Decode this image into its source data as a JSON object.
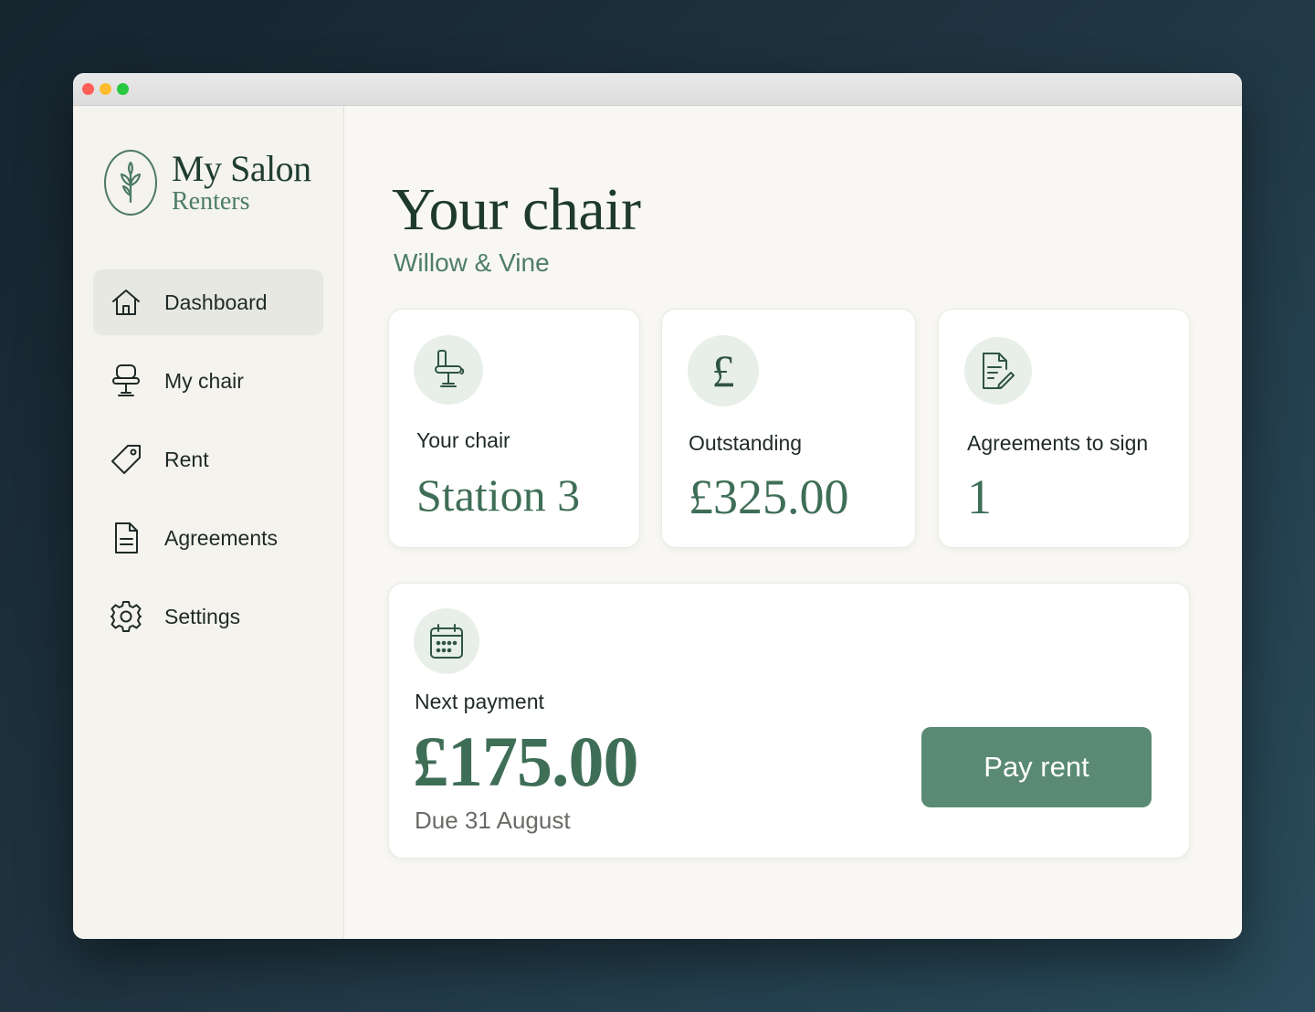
{
  "brand": {
    "name": "My Salon",
    "subtitle": "Renters"
  },
  "nav": [
    {
      "label": "Dashboard",
      "icon": "home-icon",
      "active": true
    },
    {
      "label": "My chair",
      "icon": "chair-icon",
      "active": false
    },
    {
      "label": "Rent",
      "icon": "tag-icon",
      "active": false
    },
    {
      "label": "Agreements",
      "icon": "document-icon",
      "active": false
    },
    {
      "label": "Settings",
      "icon": "gear-icon",
      "active": false
    }
  ],
  "page": {
    "title": "Your chair",
    "subtitle": "Willow & Vine"
  },
  "cards": {
    "chair": {
      "label": "Your chair",
      "value": "Station 3",
      "icon": "chair-icon"
    },
    "outstanding": {
      "label": "Outstanding",
      "value": "£325.00",
      "icon": "pound-icon"
    },
    "agreements": {
      "label": "Agreements to sign",
      "value": "1",
      "icon": "signature-document-icon"
    }
  },
  "payment": {
    "label": "Next payment",
    "amount": "£175.00",
    "due": "Due 31 August",
    "button_label": "Pay rent",
    "icon": "calendar-icon"
  },
  "colors": {
    "accent": "#5a8a74",
    "accent_text": "#3f6e57",
    "heading": "#1e3a2f",
    "icon_bg": "#e8efe9",
    "active_nav_bg": "#e7e8e1"
  }
}
